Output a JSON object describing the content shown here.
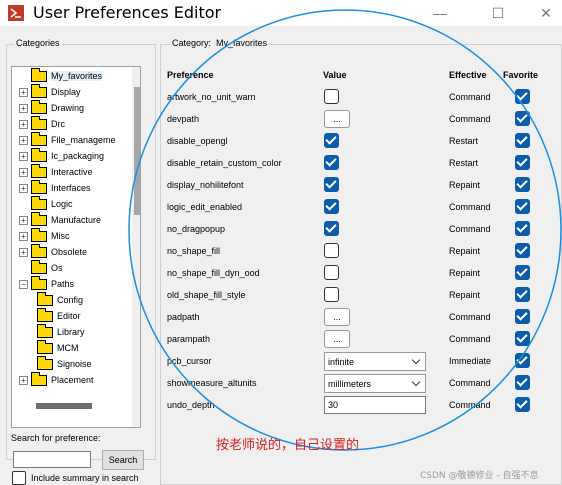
{
  "window": {
    "title": "User Preferences Editor",
    "minimize_glyph": "—",
    "maximize_glyph": "☐",
    "close_glyph": "✕"
  },
  "categories": {
    "label": "Categories",
    "items": [
      {
        "label": "My_favorites",
        "expander": "",
        "selected": true
      },
      {
        "label": "Display",
        "expander": "+"
      },
      {
        "label": "Drawing",
        "expander": "+"
      },
      {
        "label": "Drc",
        "expander": "+"
      },
      {
        "label": "File_manageme",
        "expander": "+"
      },
      {
        "label": "Ic_packaging",
        "expander": "+"
      },
      {
        "label": "Interactive",
        "expander": "+"
      },
      {
        "label": "Interfaces",
        "expander": "+"
      },
      {
        "label": "Logic",
        "expander": ""
      },
      {
        "label": "Manufacture",
        "expander": "+"
      },
      {
        "label": "Misc",
        "expander": "+"
      },
      {
        "label": "Obsolete",
        "expander": "+"
      },
      {
        "label": "Os",
        "expander": ""
      },
      {
        "label": "Paths",
        "expander": "−"
      },
      {
        "label": "Config",
        "expander": "",
        "indent": 1
      },
      {
        "label": "Editor",
        "expander": "",
        "indent": 1
      },
      {
        "label": "Library",
        "expander": "",
        "indent": 1
      },
      {
        "label": "MCM",
        "expander": "",
        "indent": 1
      },
      {
        "label": "Signoise",
        "expander": "",
        "indent": 1
      },
      {
        "label": "Placement",
        "expander": "+"
      }
    ]
  },
  "search": {
    "label": "Search for preference:",
    "value": "",
    "button_label": "Search",
    "summary_label": "Include summary in search",
    "summary_checked": false
  },
  "main": {
    "category_prefix": "Category:",
    "category_name": "My_favorites",
    "headers": {
      "preference": "Preference",
      "value": "Value",
      "effective": "Effective",
      "favorite": "Favorite"
    },
    "rows": [
      {
        "name": "artwork_no_unit_warn",
        "value_type": "checkbox",
        "value": false,
        "effective": "Command",
        "favorite": true
      },
      {
        "name": "devpath",
        "value_type": "browse",
        "value": "...",
        "effective": "Command",
        "favorite": true
      },
      {
        "name": "disable_opengl",
        "value_type": "checkbox",
        "value": true,
        "effective": "Restart",
        "favorite": true
      },
      {
        "name": "disable_retain_custom_color",
        "value_type": "checkbox",
        "value": true,
        "effective": "Restart",
        "favorite": true
      },
      {
        "name": "display_nohilitefont",
        "value_type": "checkbox",
        "value": true,
        "effective": "Repaint",
        "favorite": true
      },
      {
        "name": "logic_edit_enabled",
        "value_type": "checkbox",
        "value": true,
        "effective": "Command",
        "favorite": true
      },
      {
        "name": "no_dragpopup",
        "value_type": "checkbox",
        "value": true,
        "effective": "Command",
        "favorite": true
      },
      {
        "name": "no_shape_fill",
        "value_type": "checkbox",
        "value": false,
        "effective": "Repaint",
        "favorite": true
      },
      {
        "name": "no_shape_fill_dyn_ood",
        "value_type": "checkbox",
        "value": false,
        "effective": "Repaint",
        "favorite": true
      },
      {
        "name": "old_shape_fill_style",
        "value_type": "checkbox",
        "value": false,
        "effective": "Repaint",
        "favorite": true
      },
      {
        "name": "padpath",
        "value_type": "browse",
        "value": "...",
        "effective": "Command",
        "favorite": true
      },
      {
        "name": "parampath",
        "value_type": "browse",
        "value": "...",
        "effective": "Command",
        "favorite": true
      },
      {
        "name": "pcb_cursor",
        "value_type": "dropdown",
        "value": "infinite",
        "effective": "Immediate",
        "favorite": true
      },
      {
        "name": "showmeasure_altunits",
        "value_type": "dropdown",
        "value": "millimeters",
        "effective": "Command",
        "favorite": true
      },
      {
        "name": "undo_depth",
        "value_type": "text",
        "value": "30",
        "effective": "Command",
        "favorite": true
      }
    ]
  },
  "annotation": {
    "note": "按老师说的，自己设置的",
    "color": "#d62020",
    "circle_color": "#1a8fe0"
  },
  "watermark": "CSDN @敬德修业 - 自强不息",
  "colors": {
    "checkbox_on": "#0b5cad",
    "folder": "#ffd800"
  }
}
